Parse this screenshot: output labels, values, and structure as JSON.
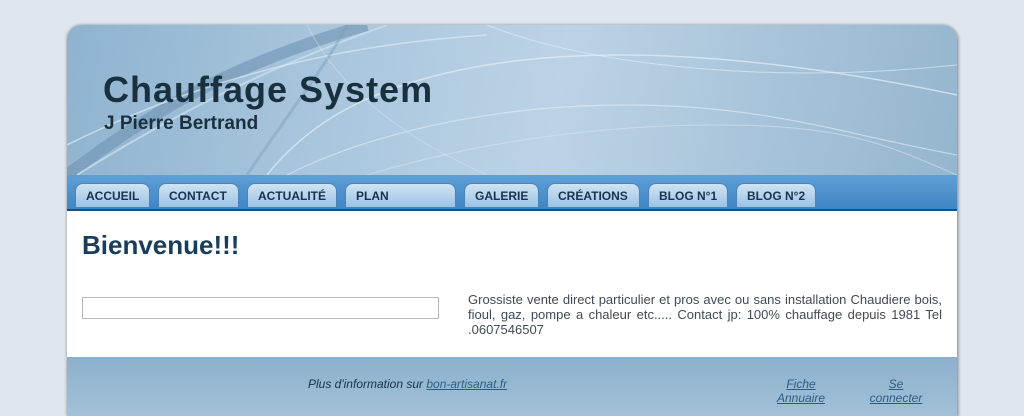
{
  "header": {
    "title": "Chauffage System",
    "subtitle": "J Pierre Bertrand"
  },
  "nav": {
    "items": [
      {
        "label": "ACCUEIL"
      },
      {
        "label": "CONTACT"
      },
      {
        "label": "ACTUALITÉ"
      },
      {
        "label": "PLAN"
      },
      {
        "label": "GALERIE"
      },
      {
        "label": "CRÉATIONS"
      },
      {
        "label": "BLOG N°1"
      },
      {
        "label": "BLOG N°2"
      }
    ]
  },
  "main": {
    "heading": "Bienvenue!!!",
    "text_field_value": "",
    "description": "Grossiste vente direct particulier et pros avec ou sans installation Chaudiere bois, fioul, gaz, pompe a chaleur etc..... Contact jp: 100% chauffage depuis 1981 Tel .0607546507"
  },
  "footer": {
    "info_prefix": "Plus d'information sur",
    "info_link": "bon-artisanat.fr",
    "fiche_line1": "Fiche",
    "fiche_line2": "Annuaire",
    "connect_line1": "Se",
    "connect_line2": "connecter"
  },
  "colors": {
    "banner": "#a9c6dd",
    "navbar": "#4a8fcf",
    "tab": "#b7d4ec",
    "heading": "#1a3d5c",
    "footer": "#95b7d0"
  }
}
